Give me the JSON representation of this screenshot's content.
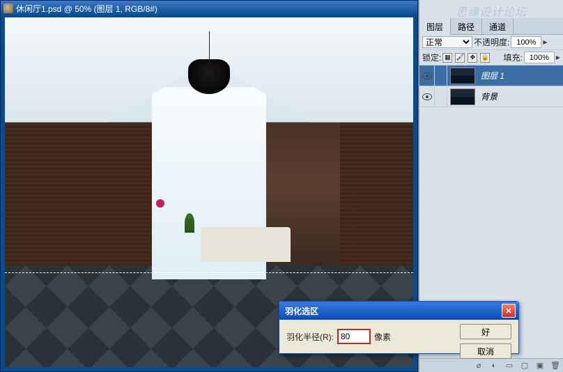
{
  "document": {
    "title_prefix": "休闲厅1.psd @ 50% (图层 1, RGB/8#)"
  },
  "watermark": "思缘设计论坛",
  "layers_panel": {
    "tabs": [
      "图层",
      "路径",
      "通道"
    ],
    "active_tab": 0,
    "blend_mode": "正常",
    "opacity_label": "不透明度:",
    "opacity_value": "100%",
    "lock_label": "锁定:",
    "fill_label": "填充:",
    "fill_value": "100%",
    "layers": [
      {
        "name": "图层 1",
        "visible": true,
        "selected": true
      },
      {
        "name": "背景",
        "visible": true,
        "selected": false
      }
    ]
  },
  "dialog": {
    "title": "羽化选区",
    "radius_label": "羽化半径(R):",
    "radius_value": "80",
    "unit": "像素",
    "ok": "好",
    "cancel": "取消"
  }
}
